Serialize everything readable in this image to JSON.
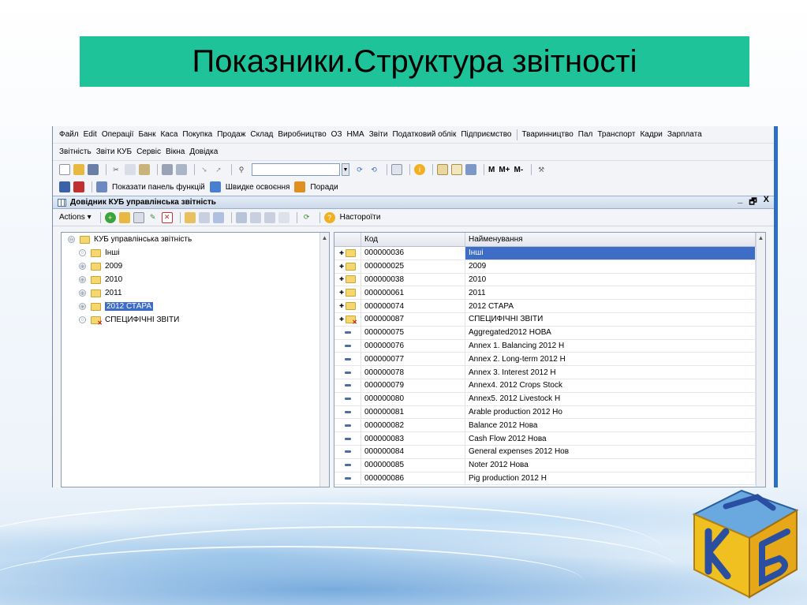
{
  "slide": {
    "title": "Показники.Структура звітності"
  },
  "menu1": [
    "Файл",
    "Edit",
    "Операції",
    "Банк",
    "Каса",
    "Покупка",
    "Продаж",
    "Склад",
    "Виробництво",
    "ОЗ",
    "НМА",
    "Звіти",
    "Податковий облік",
    "Підприємство"
  ],
  "menu1b": [
    "Тваринництво",
    "Пал",
    "Транспорт",
    "Кадри",
    "Зарплата"
  ],
  "menu2": [
    "Звітність",
    "Звіти КУБ",
    "Сервіс",
    "Вікна",
    "Довідка"
  ],
  "toolbar": {
    "m1": "М",
    "m2": "М+",
    "m3": "М-"
  },
  "toolbar2": {
    "panel": "Показати панель функцій",
    "learn": "Швидке освоєння",
    "tips": "Поради"
  },
  "window": {
    "title": "Довідник КУБ управлінська звітність",
    "min": "_",
    "restore": "🗗",
    "close": "X"
  },
  "actions": {
    "actions_label": "Actions ▾",
    "settings": "Настороїти"
  },
  "tree": {
    "root": "КУБ управлінська звітність",
    "items": [
      {
        "label": "Інші",
        "expander": "○",
        "red": false,
        "selected": false
      },
      {
        "label": "2009",
        "expander": "⊕",
        "red": false,
        "selected": false
      },
      {
        "label": "2010",
        "expander": "⊕",
        "red": false,
        "selected": false
      },
      {
        "label": "2011",
        "expander": "⊕",
        "red": false,
        "selected": false
      },
      {
        "label": "2012 СТАРА",
        "expander": "⊕",
        "red": false,
        "selected": true
      },
      {
        "label": "СПЕЦИФІЧНІ ЗВІТИ",
        "expander": "○",
        "red": true,
        "selected": false
      }
    ]
  },
  "list": {
    "headers": {
      "code": "Код",
      "name": "Найменування"
    },
    "rows": [
      {
        "kind": "folder",
        "code": "000000036",
        "name": "Інші",
        "selected": true
      },
      {
        "kind": "folder",
        "code": "000000025",
        "name": "2009"
      },
      {
        "kind": "folder",
        "code": "000000038",
        "name": "2010"
      },
      {
        "kind": "folder",
        "code": "000000061",
        "name": "2011"
      },
      {
        "kind": "folder",
        "code": "000000074",
        "name": "2012  СТАРА"
      },
      {
        "kind": "folder-red",
        "code": "000000087",
        "name": "СПЕЦИФІЧНІ ЗВІТИ"
      },
      {
        "kind": "item",
        "code": "000000075",
        "name": "Aggregated2012   НОВА"
      },
      {
        "kind": "item",
        "code": "000000076",
        "name": "Annex 1. Balancing 2012 Н"
      },
      {
        "kind": "item",
        "code": "000000077",
        "name": "Annex 2. Long-term 2012 Н"
      },
      {
        "kind": "item",
        "code": "000000078",
        "name": "Annex 3. Interest 2012 Н"
      },
      {
        "kind": "item",
        "code": "000000079",
        "name": "Annex4. 2012 Crops Stock"
      },
      {
        "kind": "item",
        "code": "000000080",
        "name": "Annex5. 2012 Livestock  Н"
      },
      {
        "kind": "item",
        "code": "000000081",
        "name": "Arable production 2012 Но"
      },
      {
        "kind": "item",
        "code": "000000082",
        "name": "Balance 2012 Нова"
      },
      {
        "kind": "item",
        "code": "000000083",
        "name": "Cash Flow  2012  Нова"
      },
      {
        "kind": "item",
        "code": "000000084",
        "name": "General expenses 2012 Нов"
      },
      {
        "kind": "item",
        "code": "000000085",
        "name": "Noter 2012 Нова"
      },
      {
        "kind": "item",
        "code": "000000086",
        "name": "Pig production  2012 Н"
      }
    ]
  },
  "logo": {
    "text": "КУБ"
  }
}
